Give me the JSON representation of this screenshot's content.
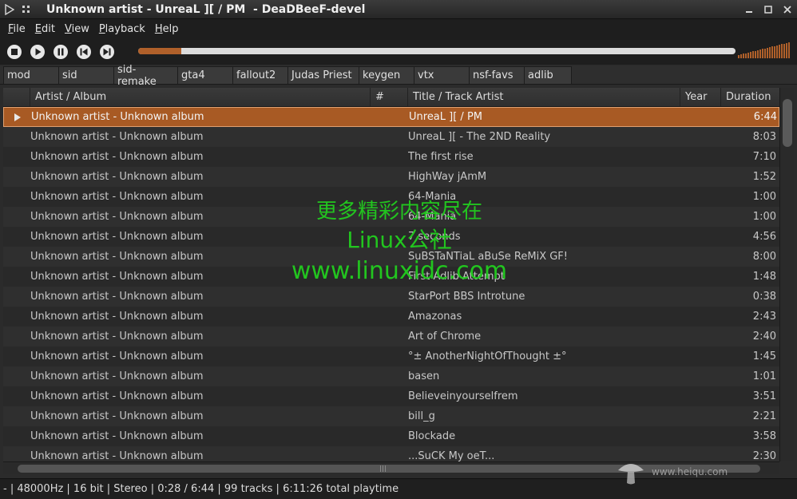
{
  "window": {
    "title": "Unknown artist - UnreaL ][ / PM  - DeaDBeeF-devel"
  },
  "menu": [
    {
      "label": "File",
      "accel": "F",
      "rest": "ile"
    },
    {
      "label": "Edit",
      "accel": "E",
      "rest": "dit"
    },
    {
      "label": "View",
      "accel": "V",
      "rest": "iew"
    },
    {
      "label": "Playback",
      "accel": "P",
      "rest": "layback"
    },
    {
      "label": "Help",
      "accel": "H",
      "rest": "elp"
    }
  ],
  "toolbar": {
    "buttons": [
      "stop-icon",
      "play-icon",
      "pause-icon",
      "prev-icon",
      "next-icon"
    ],
    "seek_progress": 0.0725,
    "volume_level": 1.0,
    "accent_color": "#b0602a"
  },
  "tabs": [
    "mod",
    "sid",
    "sid-remake",
    "gta4",
    "fallout2",
    "Judas Priest",
    "keygen",
    "vtx",
    "nsf-favs",
    "adlib"
  ],
  "columns": {
    "artist_album": "Artist / Album",
    "number": "#",
    "title": "Title / Track Artist",
    "year": "Year",
    "duration": "Duration"
  },
  "rows": [
    {
      "artist": "Unknown artist - Unknown album",
      "title": "UnreaL ][ / PM",
      "duration": "6:44",
      "playing": true
    },
    {
      "artist": "Unknown artist - Unknown album",
      "title": "UnreaL ][ - The 2ND Reality",
      "duration": "8:03"
    },
    {
      "artist": "Unknown artist - Unknown album",
      "title": "The first rise",
      "duration": "7:10"
    },
    {
      "artist": "Unknown artist - Unknown album",
      "title": "HighWay jAmM",
      "duration": "1:52"
    },
    {
      "artist": "Unknown artist - Unknown album",
      "title": "64-Mania",
      "duration": "1:00"
    },
    {
      "artist": "Unknown artist - Unknown album",
      "title": "64-Mania",
      "duration": "1:00"
    },
    {
      "artist": "Unknown artist - Unknown album",
      "title": "7 seconds",
      "duration": "4:56"
    },
    {
      "artist": "Unknown artist - Unknown album",
      "title": "SuBSTaNTiaL aBuSe ReMiX GF!",
      "duration": "8:00"
    },
    {
      "artist": "Unknown artist - Unknown album",
      "title": "First Adlib Attempt",
      "duration": "1:48"
    },
    {
      "artist": "Unknown artist - Unknown album",
      "title": "StarPort BBS Introtune",
      "duration": "0:38"
    },
    {
      "artist": "Unknown artist - Unknown album",
      "title": "Amazonas",
      "duration": "2:43"
    },
    {
      "artist": "Unknown artist - Unknown album",
      "title": "Art of Chrome",
      "duration": "2:40"
    },
    {
      "artist": "Unknown artist - Unknown album",
      "title": "°± AnotherNightOfThought ±°",
      "duration": "1:45"
    },
    {
      "artist": "Unknown artist - Unknown album",
      "title": "basen",
      "duration": "1:01"
    },
    {
      "artist": "Unknown artist - Unknown album",
      "title": "Believeinyourselfrem",
      "duration": "3:51"
    },
    {
      "artist": "Unknown artist - Unknown album",
      "title": "bill_g",
      "duration": "2:21"
    },
    {
      "artist": "Unknown artist - Unknown album",
      "title": "Blockade",
      "duration": "3:58"
    },
    {
      "artist": "Unknown artist - Unknown album",
      "title": "...SuCK My oeT...",
      "duration": "2:30"
    }
  ],
  "statusbar": {
    "text": "- | 48000Hz | 16 bit | Stereo | 0:28 / 6:44 | 99 tracks | 6:11:26 total playtime"
  },
  "watermark": {
    "line1": "更多精彩内容尽在",
    "line2": "Linux公社",
    "line3": "www.linuxidc.com"
  },
  "corner_logo": {
    "site": "www.heiqu.com"
  }
}
